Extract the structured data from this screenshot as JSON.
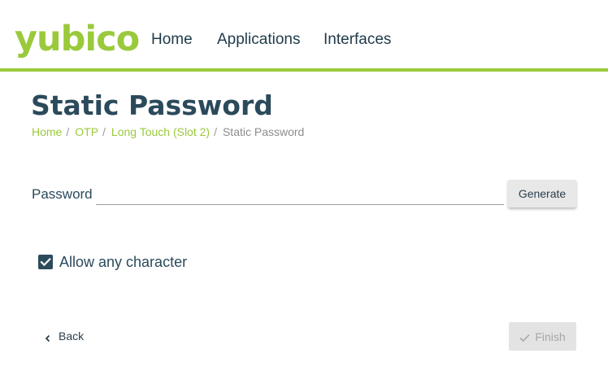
{
  "header": {
    "logo_text": "yubico",
    "nav": [
      {
        "label": "Home"
      },
      {
        "label": "Applications"
      },
      {
        "label": "Interfaces"
      }
    ],
    "accent_color": "#9aca3c"
  },
  "page": {
    "title": "Static Password",
    "breadcrumb": [
      {
        "label": "Home",
        "link": true
      },
      {
        "label": "OTP",
        "link": true
      },
      {
        "label": "Long Touch (Slot 2)",
        "link": true
      },
      {
        "label": "Static Password",
        "link": false
      }
    ]
  },
  "form": {
    "password_label": "Password",
    "password_value": "",
    "generate_label": "Generate",
    "allow_any_character": {
      "label": "Allow any character",
      "checked": true
    }
  },
  "footer": {
    "back_label": "Back",
    "back_icon": "chevron-left-icon",
    "finish_label": "Finish",
    "finish_icon": "check-icon",
    "finish_disabled": true
  }
}
